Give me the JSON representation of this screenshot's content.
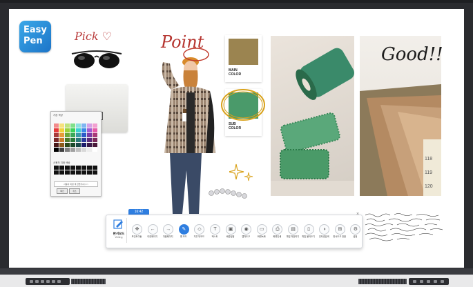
{
  "logo": {
    "line1": "Easy",
    "line2": "Pen"
  },
  "canvas": {
    "pick_text": "Pick",
    "point_text": "Point",
    "good_text": "Good!!",
    "main_swatch": {
      "label1": "MAIN",
      "label2": "COLOR",
      "color": "#9b8450"
    },
    "sub_swatch": {
      "label1": "SUB",
      "label2": "COLOR",
      "color": "#4a9a6a"
    }
  },
  "color_picker": {
    "title": "기본 색상",
    "custom_title": "사용자 지정 색상",
    "field_text": "사용자 지정 색 만들기(D) >>",
    "ok_label": "확인",
    "cancel_label": "취소",
    "palette": [
      "#f28b8b",
      "#f6e27a",
      "#bfe37d",
      "#7fe08a",
      "#8de0e0",
      "#7fb6f2",
      "#d6a0e6",
      "#f2a0d0",
      "#e63a3a",
      "#f2d23a",
      "#9ad23a",
      "#3ad25a",
      "#3ad2d2",
      "#3a8ae6",
      "#a05ad2",
      "#e65aa8",
      "#a83a3a",
      "#e69a3a",
      "#6aa83a",
      "#3aa85a",
      "#3a9aa8",
      "#2a5ac8",
      "#7a3aa8",
      "#a83a78",
      "#7a2a2a",
      "#c87a2a",
      "#4a7a2a",
      "#2a7a3a",
      "#2a7a7a",
      "#2a3a9a",
      "#5a2a7a",
      "#7a2a5a",
      "#4a1a1a",
      "#8a5a1a",
      "#2a4a1a",
      "#1a4a2a",
      "#1a4a4a",
      "#1a1a6a",
      "#3a1a4a",
      "#4a1a3a",
      "#000000",
      "#404040",
      "#808080",
      "#a0a0a0",
      "#c0c0c0",
      "#d8d8d8",
      "#ececec",
      "#ffffff"
    ]
  },
  "toolbar": {
    "time": "16:42",
    "mode_label": "판서모드",
    "mode_sub": "Writing",
    "tools": [
      {
        "label": "포인트이동",
        "icon": "✥"
      },
      {
        "label": "이전페이지",
        "icon": "←"
      },
      {
        "label": "다음페이지",
        "icon": "→"
      },
      {
        "label": "펜 모드",
        "icon": "✎"
      },
      {
        "label": "지우개 모드",
        "icon": "◇"
      },
      {
        "label": "텍스트",
        "icon": "T"
      },
      {
        "label": "배경설정",
        "icon": "▣"
      },
      {
        "label": "캡처도구",
        "icon": "◉"
      },
      {
        "label": "화면녹화",
        "icon": "▭"
      },
      {
        "label": "화면인쇄",
        "icon": "⎙"
      },
      {
        "label": "파일 저장하기",
        "icon": "▤"
      },
      {
        "label": "파일 불러오기",
        "icon": "▯"
      },
      {
        "label": "인터넷검색",
        "icon": "◑"
      },
      {
        "label": "판서도구 전환",
        "icon": "⊞"
      },
      {
        "label": "설정",
        "icon": "⚙"
      }
    ]
  },
  "colors": {
    "accent": "#2f7ee0",
    "bezel": "#2a2b2f"
  }
}
